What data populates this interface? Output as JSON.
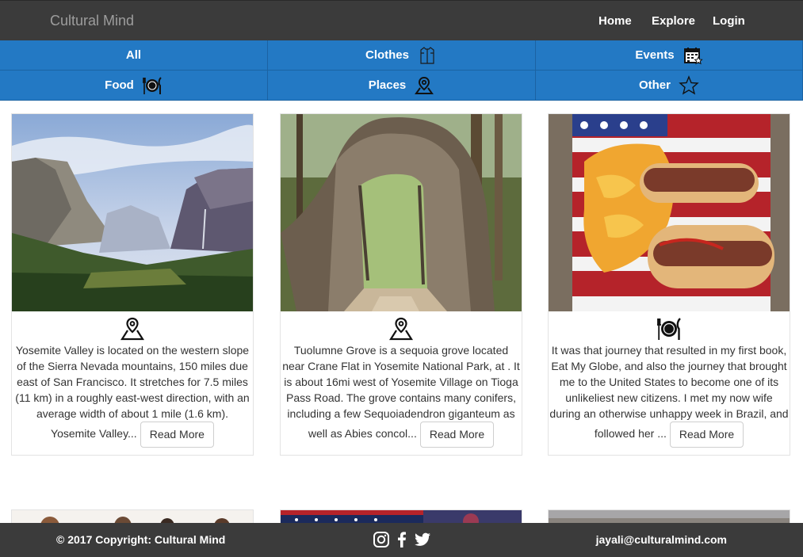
{
  "navbar": {
    "brand": "Cultural Mind",
    "links": [
      {
        "label": "Home"
      },
      {
        "label": "Explore"
      },
      {
        "label": "Login"
      }
    ]
  },
  "categories": [
    {
      "label": "All",
      "icon": ""
    },
    {
      "label": "Clothes",
      "icon": "shirt-icon"
    },
    {
      "label": "Events",
      "icon": "calendar-icon"
    },
    {
      "label": "Food",
      "icon": "plate-fork-knife-icon"
    },
    {
      "label": "Places",
      "icon": "map-pin-icon"
    },
    {
      "label": "Other",
      "icon": "star-icon"
    }
  ],
  "cards": [
    {
      "image": "yosemite-valley-photo",
      "type_icon": "map-pin-icon",
      "text": "Yosemite Valley is located on the western slope of the Sierra Nevada mountains, 150 miles due east of San Francisco. It stretches for 7.5 miles (11 km) in a roughly east-west direction, with an average width of about 1 mile (1.6 km). Yosemite Valley...",
      "button": "Read More"
    },
    {
      "image": "tree-tunnel-photo",
      "type_icon": "map-pin-icon",
      "text": "Tuolumne Grove is a sequoia grove located near Crane Flat in Yosemite National Park, at . It is about 16mi west of Yosemite Village on Tioga Pass Road. The grove contains many conifers, including a few Sequoiadendron giganteum as well as Abies concol...",
      "button": "Read More"
    },
    {
      "image": "hotdogs-flag-plate-photo",
      "type_icon": "plate-fork-knife-icon",
      "text": "It was that journey that resulted in my first book, Eat My Globe, and also the journey that brought me to the United States to become one of its unlikeliest new citizens. I met my now wife during an otherwise unhappy week in Brazil, and followed her ...",
      "button": "Read More"
    }
  ],
  "footer": {
    "copyright": "© 2017 Copyright: Cultural Mind",
    "email": "jayali@culturalmind.com",
    "social": [
      "instagram-icon",
      "facebook-icon",
      "twitter-icon"
    ]
  },
  "colors": {
    "navbar_bg": "#3b3b3b",
    "category_bar": "#2379c4",
    "brand_text": "#9d9d9d"
  }
}
